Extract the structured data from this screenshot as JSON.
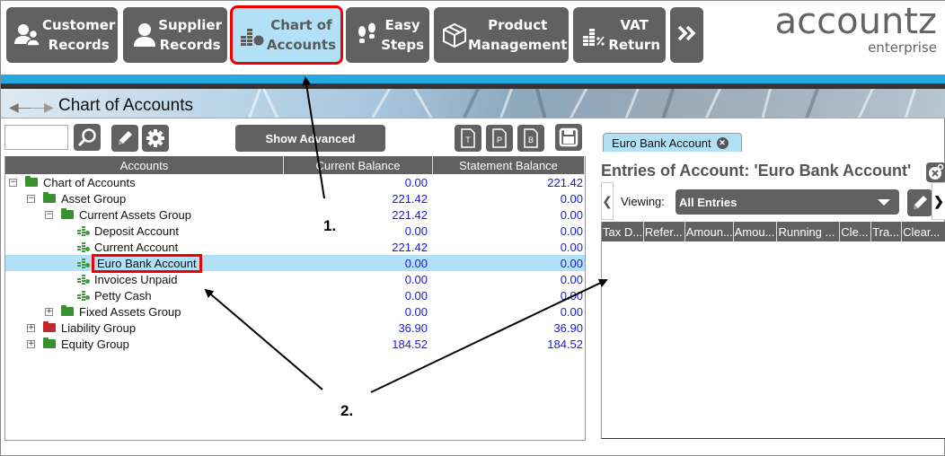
{
  "nav": {
    "buttons": [
      {
        "line1": "Customer",
        "line2": "Records",
        "icon": "customer-records-icon",
        "active": false
      },
      {
        "line1": "Supplier",
        "line2": "Records",
        "icon": "supplier-records-icon",
        "active": false
      },
      {
        "line1": "Chart of",
        "line2": "Accounts",
        "icon": "chart-of-accounts-icon",
        "active": true
      },
      {
        "line1": "Easy",
        "line2": "Steps",
        "icon": "footsteps-icon",
        "active": false
      },
      {
        "line1": "Product",
        "line2": "Management",
        "icon": "box-icon",
        "active": false
      },
      {
        "line1": "VAT",
        "line2": "Return",
        "icon": "vat-return-icon",
        "active": false
      }
    ],
    "more_icon": "double-chevron-right-icon"
  },
  "logo": {
    "main": "accountz",
    "sub": "enterprise"
  },
  "page": {
    "title": "Chart of Accounts"
  },
  "toolbar": {
    "search_value": "",
    "show_advanced_label": "Show Advanced",
    "report_buttons": [
      "T",
      "P",
      "B"
    ]
  },
  "tree": {
    "columns": [
      "Accounts",
      "Current Balance",
      "Statement Balance"
    ],
    "rows": [
      {
        "name": "Chart of Accounts",
        "level": 0,
        "type": "folder",
        "toggle": "−",
        "color": "#3a8f2e",
        "current": "0.00",
        "statement": "221.42",
        "selected": false
      },
      {
        "name": "Asset Group",
        "level": 1,
        "type": "folder",
        "toggle": "−",
        "color": "#3a8f2e",
        "current": "221.42",
        "statement": "0.00",
        "selected": false
      },
      {
        "name": "Current Assets Group",
        "level": 2,
        "type": "folder",
        "toggle": "−",
        "color": "#3a8f2e",
        "current": "221.42",
        "statement": "0.00",
        "selected": false
      },
      {
        "name": "Deposit Account",
        "level": 3,
        "type": "account",
        "current": "0.00",
        "statement": "0.00",
        "selected": false
      },
      {
        "name": "Current Account",
        "level": 3,
        "type": "account",
        "current": "221.42",
        "statement": "0.00",
        "selected": false
      },
      {
        "name": "Euro Bank Account",
        "level": 3,
        "type": "account",
        "current": "0.00",
        "statement": "0.00",
        "selected": true
      },
      {
        "name": "Invoices Unpaid",
        "level": 3,
        "type": "account",
        "current": "0.00",
        "statement": "0.00",
        "selected": false
      },
      {
        "name": "Petty Cash",
        "level": 3,
        "type": "account",
        "current": "0.00",
        "statement": "0.00",
        "selected": false
      },
      {
        "name": "Fixed Assets Group",
        "level": 2,
        "type": "folder",
        "toggle": "+",
        "color": "#3a8f2e",
        "current": "0.00",
        "statement": "0.00",
        "selected": false
      },
      {
        "name": "Liability Group",
        "level": 1,
        "type": "folder",
        "toggle": "+",
        "color": "#c4262e",
        "current": "36.90",
        "statement": "36.90",
        "selected": false
      },
      {
        "name": "Equity Group",
        "level": 1,
        "type": "folder",
        "toggle": "+",
        "color": "#3a8f2e",
        "current": "184.52",
        "statement": "184.52",
        "selected": false
      }
    ]
  },
  "right": {
    "tab_label": "Euro Bank Account",
    "entries_title": "Entries of Account:  'Euro Bank Account'",
    "viewing_label": "Viewing:",
    "viewing_value": "All Entries",
    "columns": [
      "Tax D...",
      "Refer...",
      "Amoun...",
      "Amou...",
      "Running ...",
      "Cle...",
      "Tra...",
      "Clear..."
    ]
  },
  "annotations": {
    "one": "1.",
    "two": "2."
  },
  "colors": {
    "button": "#616161",
    "active": "#b2e0f7",
    "highlight": "#e00000",
    "value": "#1a1adb",
    "band": "#26a8e0"
  }
}
